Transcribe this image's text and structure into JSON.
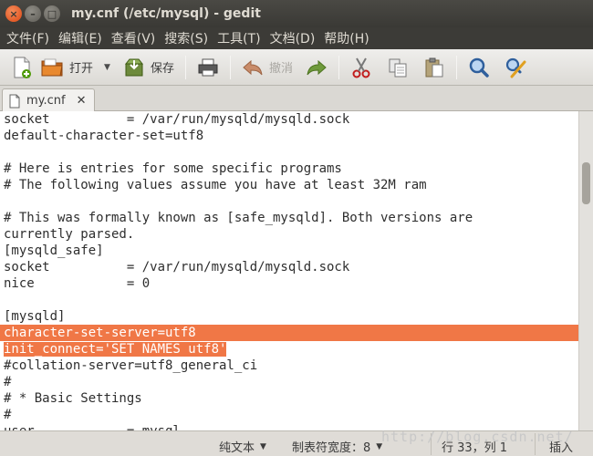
{
  "window": {
    "title": "my.cnf (/etc/mysql) - gedit",
    "close_glyph": "×",
    "min_glyph": "–",
    "max_glyph": "□"
  },
  "menu": [
    "文件(F)",
    "编辑(E)",
    "查看(V)",
    "搜索(S)",
    "工具(T)",
    "文档(D)",
    "帮助(H)"
  ],
  "toolbar": {
    "open_label": "打开",
    "save_label": "保存",
    "undo_label": "撤消",
    "dropdown_glyph": "▼"
  },
  "tab": {
    "label": "my.cnf",
    "close_glyph": "✕"
  },
  "editor": {
    "lines": [
      "socket          = /var/run/mysqld/mysqld.sock",
      "default-character-set=utf8",
      "",
      "# Here is entries for some specific programs",
      "# The following values assume you have at least 32M ram",
      "",
      "# This was formally known as [safe_mysqld]. Both versions are",
      "currently parsed.",
      "[mysqld_safe]",
      "socket          = /var/run/mysqld/mysqld.sock",
      "nice            = 0",
      "",
      "[mysqld]",
      "character-set-server=utf8",
      "init_connect='SET NAMES utf8'",
      "#collation-server=utf8_general_ci",
      "#",
      "# * Basic Settings",
      "#",
      "user            = mysql"
    ]
  },
  "watermark": "http://blog.csdn.net/",
  "status": {
    "language": "纯文本",
    "tab_width": "制表符宽度：8",
    "position": "行 33，列 1",
    "mode": "插入",
    "caret": "▼"
  }
}
